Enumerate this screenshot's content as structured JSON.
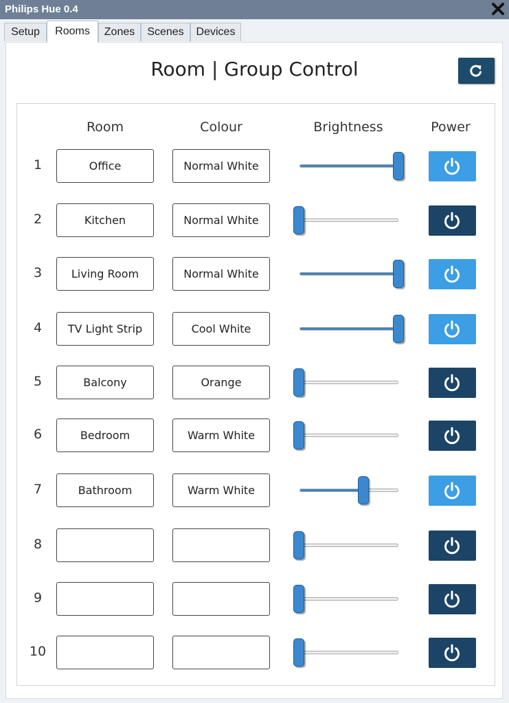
{
  "window": {
    "title": "Philips Hue 0.4"
  },
  "tabs": [
    "Setup",
    "Rooms",
    "Zones",
    "Scenes",
    "Devices"
  ],
  "active_tab": "Rooms",
  "heading": "Room | Group Control",
  "columns": {
    "room": "Room",
    "colour": "Colour",
    "brightness": "Brightness",
    "power": "Power"
  },
  "colors": {
    "power_on": "#3c9ee5",
    "power_off": "#1b4466",
    "slider": "#3b88cf",
    "titlebar": "#6f8096"
  },
  "rows": [
    {
      "num": "1",
      "room": "Office",
      "colour": "Normal White",
      "brightness": 1.0,
      "power": "on"
    },
    {
      "num": "2",
      "room": "Kitchen",
      "colour": "Normal White",
      "brightness": 0.0,
      "power": "off"
    },
    {
      "num": "3",
      "room": "Living Room",
      "colour": "Normal White",
      "brightness": 1.0,
      "power": "on"
    },
    {
      "num": "4",
      "room": "TV Light Strip",
      "colour": "Cool White",
      "brightness": 1.0,
      "power": "on"
    },
    {
      "num": "5",
      "room": "Balcony",
      "colour": "Orange",
      "brightness": 0.0,
      "power": "off"
    },
    {
      "num": "6",
      "room": "Bedroom",
      "colour": "Warm White",
      "brightness": 0.0,
      "power": "off"
    },
    {
      "num": "7",
      "room": "Bathroom",
      "colour": "Warm White",
      "brightness": 0.65,
      "power": "on"
    },
    {
      "num": "8",
      "room": "",
      "colour": "",
      "brightness": 0.0,
      "power": "off"
    },
    {
      "num": "9",
      "room": "",
      "colour": "",
      "brightness": 0.0,
      "power": "off"
    },
    {
      "num": "10",
      "room": "",
      "colour": "",
      "brightness": 0.0,
      "power": "off"
    }
  ]
}
